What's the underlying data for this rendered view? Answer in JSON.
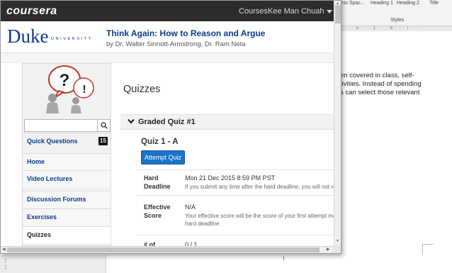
{
  "background_doc": {
    "styles": [
      "No Spac...",
      "Heading 1",
      "Heading 2",
      "Title"
    ],
    "styles_group_label": "Styles",
    "ruler": "· · · · 5 · · · 1 · · · 6 · · · ı · · · ·",
    "text_lines": [
      "en covered in class, self-",
      "tivities. Instead of spending",
      "s can select those relevant"
    ]
  },
  "topbar": {
    "logo": "coursera",
    "courses_link": "Courses",
    "user_name": "Kee Man Chuah"
  },
  "course": {
    "university_word": "Duke",
    "university_sub": "UNIVERSITY",
    "title": "Think Again: How to Reason and Argue",
    "authors": "by Dr. Walter Sinnott-Armstrong, Dr. Ram Neta"
  },
  "sidebar": {
    "search_placeholder": "",
    "items": [
      {
        "label": "Quick Questions",
        "badge": "15"
      },
      {
        "label": "Home"
      },
      {
        "label": "Video Lectures"
      },
      {
        "label": "Discussion Forums"
      },
      {
        "label": "Exercises"
      },
      {
        "label": "Quizzes"
      }
    ]
  },
  "main": {
    "heading": "Quizzes",
    "section_title": "Graded Quiz #1",
    "quiz_name": "Quiz 1 - A",
    "attempt_label": "Attempt Quiz",
    "rows": [
      {
        "label_1": "Hard",
        "label_2": "Deadline",
        "value": "Mon 21 Dec 2015 8:59 PM PST",
        "note": "If you submit any time after the hard deadline, you will not rec"
      },
      {
        "label_1": "Effective",
        "label_2": "Score",
        "value": "N/A",
        "note_1": "Your effective score will be the score of your first attempt mac",
        "note_2": "hard deadline."
      },
      {
        "label_1": "# of",
        "value": "0 / 1"
      }
    ]
  },
  "colors": {
    "topbar_bg": "#2d2d2d",
    "duke_blue": "#0b3b8c",
    "button_blue": "#1a73c8"
  }
}
